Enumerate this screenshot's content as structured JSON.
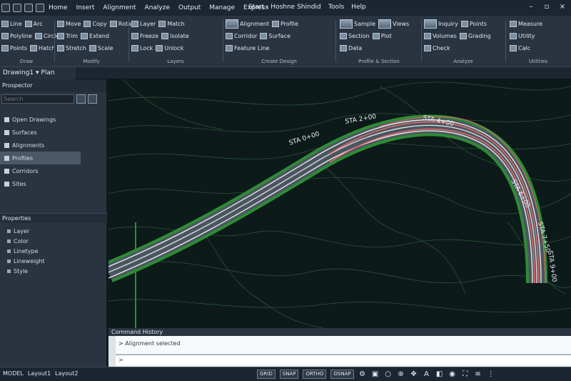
{
  "app": {
    "title": "Start ‹ Hoshne Shindid",
    "quick_access": [
      "qa-1",
      "qa-2",
      "qa-3",
      "qa-4"
    ],
    "menus": [
      "Home",
      "Insert",
      "Alignment",
      "Analyze",
      "Output",
      "Manage",
      "Express"
    ],
    "title_tools": [
      "Tools",
      "Help"
    ],
    "window_controls": [
      "minimize-icon",
      "restore-icon",
      "close-icon"
    ]
  },
  "ribbon": {
    "groups": [
      {
        "title": "Draw",
        "rows": [
          [
            "Line",
            "Arc"
          ],
          [
            "Polyline",
            "Circle"
          ],
          [
            "Points",
            "Hatch"
          ]
        ]
      },
      {
        "title": "Modify",
        "rows": [
          [
            "Move",
            "Copy",
            "Rotate"
          ],
          [
            "Trim",
            "Extend"
          ],
          [
            "Stretch",
            "Scale"
          ]
        ]
      },
      {
        "title": "Layers",
        "rows": [
          [
            "Layer",
            "Match"
          ],
          [
            "Freeze",
            "Isolate"
          ],
          [
            "Lock",
            "Unlock"
          ]
        ]
      },
      {
        "title": "Create Design",
        "rows": [
          [
            "Alignment",
            "Profile"
          ],
          [
            "Corridor",
            "Surface"
          ],
          [
            "Feature Line"
          ]
        ]
      },
      {
        "title": "Profile & Section",
        "rows": [
          [
            "Sample",
            "Views"
          ],
          [
            "Section",
            "Plot"
          ],
          [
            "Data"
          ]
        ]
      },
      {
        "title": "Analyze",
        "rows": [
          [
            "Inquiry",
            "Points"
          ],
          [
            "Volumes",
            "Grading"
          ],
          [
            "Check"
          ]
        ]
      },
      {
        "title": "Utilities",
        "rows": [
          [
            "Measure"
          ],
          [
            "Utility"
          ],
          [
            "Calc"
          ]
        ]
      }
    ]
  },
  "document_tab": "Drawing1 ▾ Plan",
  "left_panel": {
    "header": "Prospector",
    "search_placeholder": "Search",
    "tree": [
      "Open Drawings",
      "Surfaces",
      "Alignments",
      "Profiles",
      "Corridors",
      "Sites"
    ],
    "selected_index": 3,
    "section2_title": "Properties",
    "properties": [
      "Layer",
      "Color",
      "Linetype",
      "Lineweight",
      "Style"
    ]
  },
  "canvas": {
    "labels": [
      "STA 0+00",
      "STA 2+00",
      "STA 4+00",
      "STA 6+00",
      "STA 7+50",
      "STA 9+00"
    ]
  },
  "command": {
    "header": "Command History",
    "history_line": "> Alignment selected",
    "prompt": ">"
  },
  "status": {
    "left": [
      "MODEL",
      "Layout1",
      "Layout2"
    ],
    "buttons": [
      "GRID",
      "SNAP",
      "ORTHO",
      "OSNAP"
    ],
    "icons": [
      "gear-icon",
      "lock-icon",
      "search-icon",
      "zoom-icon",
      "pan-icon",
      "annotation-icon",
      "hardware-icon",
      "isolate-icon",
      "fullscreen-icon",
      "menu-icon",
      "settings-icon"
    ]
  },
  "colors": {
    "road_outer": "#2f8c35",
    "road_inner": "#e8e8e8",
    "curve_red": "#e36a6a",
    "contour": "#2c5a37"
  }
}
